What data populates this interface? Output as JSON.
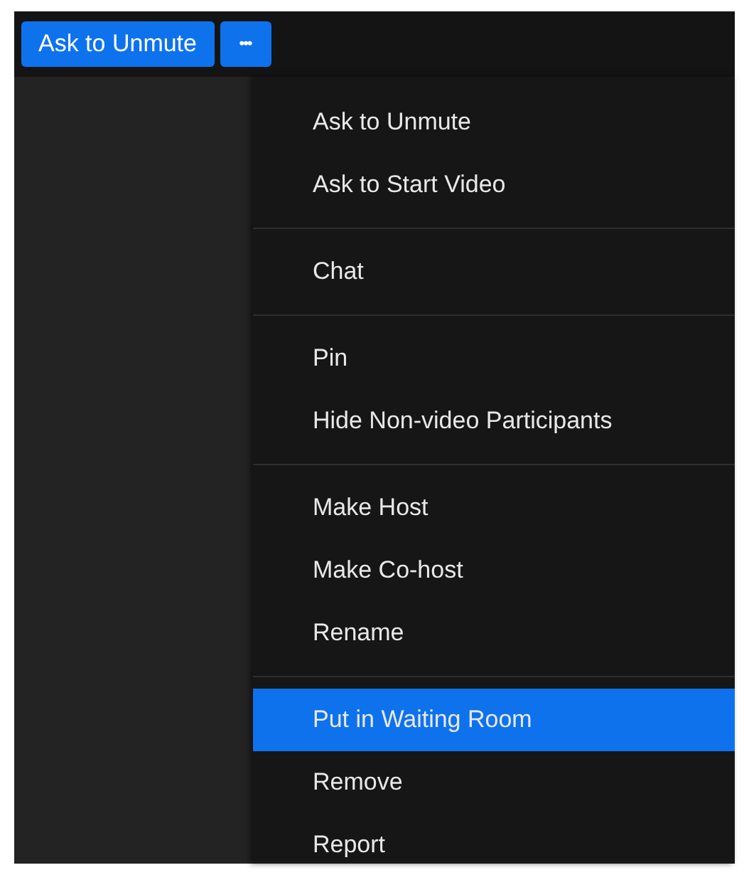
{
  "toolbar": {
    "primary_button": "Ask to Unmute",
    "more_button": "•••"
  },
  "menu": {
    "groups": [
      {
        "items": [
          {
            "label": "Ask to Unmute",
            "selected": false
          },
          {
            "label": "Ask to Start Video",
            "selected": false
          }
        ]
      },
      {
        "items": [
          {
            "label": "Chat",
            "selected": false
          }
        ]
      },
      {
        "items": [
          {
            "label": "Pin",
            "selected": false
          },
          {
            "label": "Hide Non-video Participants",
            "selected": false
          }
        ]
      },
      {
        "items": [
          {
            "label": "Make Host",
            "selected": false
          },
          {
            "label": "Make Co-host",
            "selected": false
          },
          {
            "label": "Rename",
            "selected": false
          }
        ]
      },
      {
        "items": [
          {
            "label": "Put in Waiting Room",
            "selected": true
          },
          {
            "label": "Remove",
            "selected": false
          },
          {
            "label": "Report",
            "selected": false
          }
        ]
      }
    ]
  }
}
